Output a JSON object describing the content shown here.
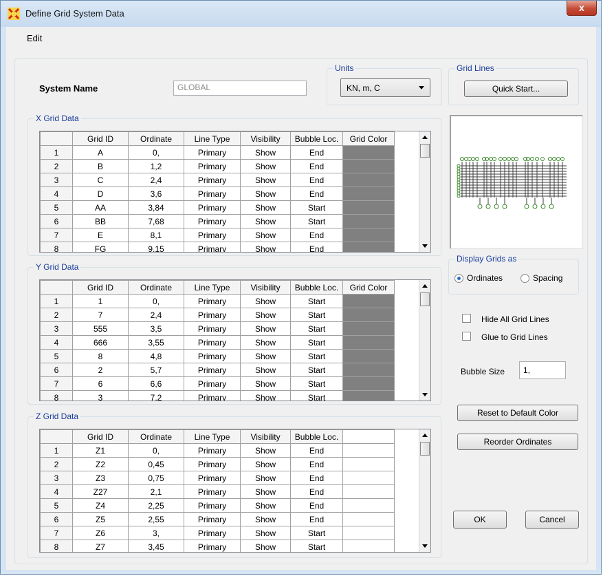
{
  "window": {
    "title": "Define Grid System Data",
    "close_glyph": "x"
  },
  "menu": {
    "edit": "Edit"
  },
  "system": {
    "label": "System Name",
    "value": "GLOBAL"
  },
  "units": {
    "label": "Units",
    "value": "KN, m, C"
  },
  "grid_lines": {
    "label": "Grid Lines",
    "quick_start": "Quick Start..."
  },
  "x_grid": {
    "label": "X Grid Data",
    "headers": [
      "Grid ID",
      "Ordinate",
      "Line Type",
      "Visibility",
      "Bubble Loc.",
      "Grid Color"
    ],
    "rows": [
      [
        "1",
        "A",
        "0,",
        "Primary",
        "Show",
        "End"
      ],
      [
        "2",
        "B",
        "1,2",
        "Primary",
        "Show",
        "End"
      ],
      [
        "3",
        "C",
        "2,4",
        "Primary",
        "Show",
        "End"
      ],
      [
        "4",
        "D",
        "3,6",
        "Primary",
        "Show",
        "End"
      ],
      [
        "5",
        "AA",
        "3,84",
        "Primary",
        "Show",
        "Start"
      ],
      [
        "6",
        "BB",
        "7,68",
        "Primary",
        "Show",
        "Start"
      ],
      [
        "7",
        "E",
        "8,1",
        "Primary",
        "Show",
        "End"
      ],
      [
        "8",
        "FG",
        "9,15",
        "Primary",
        "Show",
        "End"
      ]
    ]
  },
  "y_grid": {
    "label": "Y Grid Data",
    "headers": [
      "Grid ID",
      "Ordinate",
      "Line Type",
      "Visibility",
      "Bubble Loc.",
      "Grid Color"
    ],
    "rows": [
      [
        "1",
        "1",
        "0,",
        "Primary",
        "Show",
        "Start"
      ],
      [
        "2",
        "7",
        "2,4",
        "Primary",
        "Show",
        "Start"
      ],
      [
        "3",
        "555",
        "3,5",
        "Primary",
        "Show",
        "Start"
      ],
      [
        "4",
        "666",
        "3,55",
        "Primary",
        "Show",
        "Start"
      ],
      [
        "5",
        "8",
        "4,8",
        "Primary",
        "Show",
        "Start"
      ],
      [
        "6",
        "2",
        "5,7",
        "Primary",
        "Show",
        "Start"
      ],
      [
        "7",
        "6",
        "6,6",
        "Primary",
        "Show",
        "Start"
      ],
      [
        "8",
        "3",
        "7,2",
        "Primary",
        "Show",
        "Start"
      ]
    ]
  },
  "z_grid": {
    "label": "Z Grid Data",
    "headers": [
      "Grid ID",
      "Ordinate",
      "Line Type",
      "Visibility",
      "Bubble Loc.",
      ""
    ],
    "rows": [
      [
        "1",
        "Z1",
        "0,",
        "Primary",
        "Show",
        "End"
      ],
      [
        "2",
        "Z2",
        "0,45",
        "Primary",
        "Show",
        "End"
      ],
      [
        "3",
        "Z3",
        "0,75",
        "Primary",
        "Show",
        "End"
      ],
      [
        "4",
        "Z27",
        "2,1",
        "Primary",
        "Show",
        "End"
      ],
      [
        "5",
        "Z4",
        "2,25",
        "Primary",
        "Show",
        "End"
      ],
      [
        "6",
        "Z5",
        "2,55",
        "Primary",
        "Show",
        "End"
      ],
      [
        "7",
        "Z6",
        "3,",
        "Primary",
        "Show",
        "Start"
      ],
      [
        "8",
        "Z7",
        "3,45",
        "Primary",
        "Show",
        "Start"
      ]
    ]
  },
  "display": {
    "label": "Display Grids as",
    "ordinates": "Ordinates",
    "spacing": "Spacing",
    "selected": "Ordinates"
  },
  "options": {
    "hide_all": "Hide All Grid Lines",
    "glue": "Glue to Grid Lines"
  },
  "bubble": {
    "label": "Bubble Size",
    "value": "1,"
  },
  "buttons": {
    "reset": "Reset to Default Color",
    "reorder": "Reorder Ordinates",
    "ok": "OK",
    "cancel": "Cancel"
  },
  "colors": {
    "grid_color_cell": "#808080",
    "accent_label": "#1a3e9c",
    "preview_lines": "#3c3c3c",
    "preview_bubbles": "#3a8a2a"
  }
}
